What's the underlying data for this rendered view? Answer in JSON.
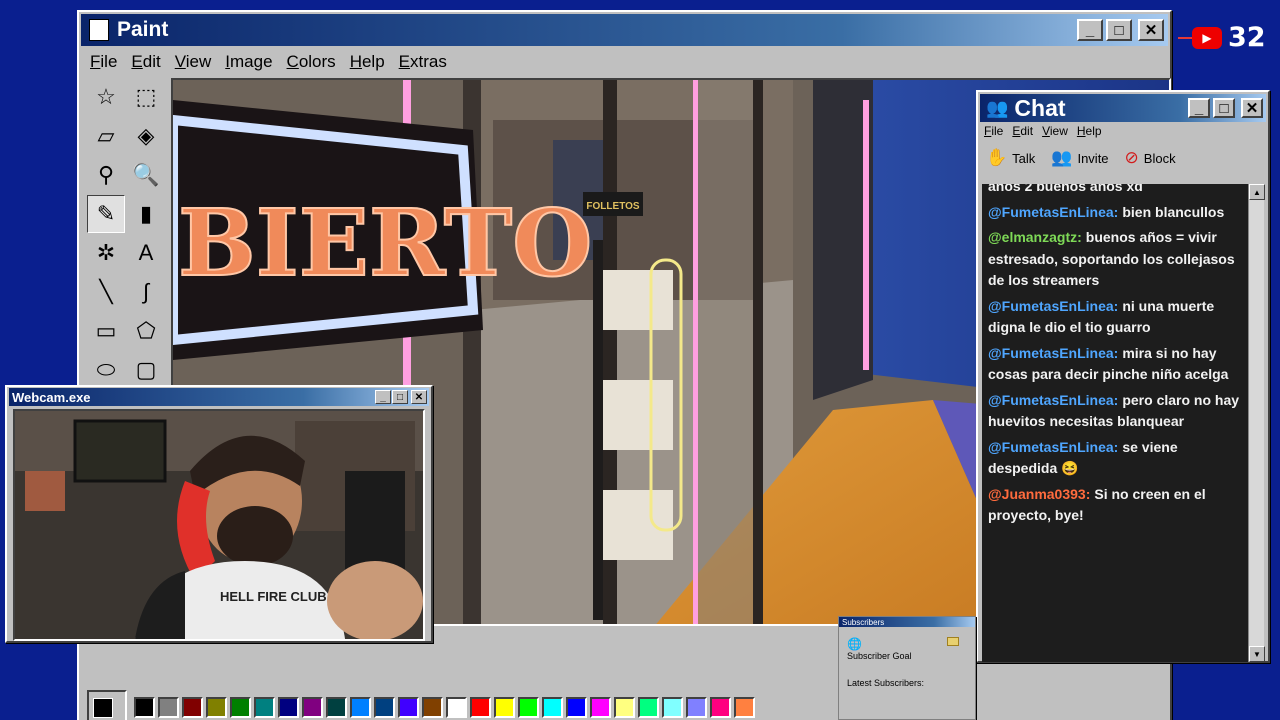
{
  "paint": {
    "title": "Paint",
    "menu": [
      "File",
      "Edit",
      "View",
      "Image",
      "Colors",
      "Help",
      "Extras"
    ],
    "tools": [
      {
        "name": "free-select-icon",
        "glyph": "☆"
      },
      {
        "name": "rect-select-icon",
        "glyph": "⬚"
      },
      {
        "name": "eraser-icon",
        "glyph": "▱"
      },
      {
        "name": "fill-bucket-icon",
        "glyph": "◈"
      },
      {
        "name": "color-picker-icon",
        "glyph": "⚲"
      },
      {
        "name": "magnifier-icon",
        "glyph": "🔍"
      },
      {
        "name": "pencil-icon",
        "glyph": "✎"
      },
      {
        "name": "brush-icon",
        "glyph": "▮"
      },
      {
        "name": "airbrush-icon",
        "glyph": "✲"
      },
      {
        "name": "text-tool-icon",
        "glyph": "A"
      },
      {
        "name": "line-tool-icon",
        "glyph": "╲"
      },
      {
        "name": "curve-tool-icon",
        "glyph": "∫"
      },
      {
        "name": "rectangle-tool-icon",
        "glyph": "▭"
      },
      {
        "name": "polygon-tool-icon",
        "glyph": "⬠"
      },
      {
        "name": "ellipse-tool-icon",
        "glyph": "⬭"
      },
      {
        "name": "rounded-rect-tool-icon",
        "glyph": "▢"
      }
    ],
    "palette": [
      "#000000",
      "#808080",
      "#800000",
      "#808000",
      "#008000",
      "#008080",
      "#000080",
      "#800080",
      "#004040",
      "#0080ff",
      "#004080",
      "#4000ff",
      "#804000",
      "#ffffff",
      "#ff0000",
      "#ffff00",
      "#00ff00",
      "#00ffff",
      "#0000ff",
      "#ff00ff",
      "#ffff80",
      "#00ff80",
      "#80ffff",
      "#8080ff",
      "#ff0080",
      "#ff8040"
    ],
    "scene_sign_text": "BIERTO",
    "scene_rack_label": "FOLLETOS"
  },
  "webcam": {
    "title": "Webcam.exe",
    "shirt_text": "HELL FIRE CLUB"
  },
  "chat": {
    "title": "Chat",
    "menu": [
      "File",
      "Edit",
      "View",
      "Help"
    ],
    "toolbar": [
      {
        "label": "Talk",
        "icon": "talk-icon",
        "glyph": "✋"
      },
      {
        "label": "Invite",
        "icon": "invite-icon",
        "glyph": "👥"
      },
      {
        "label": "Block",
        "icon": "block-icon",
        "glyph": "⊘"
      }
    ],
    "messages": [
      {
        "user": "",
        "text": "años 2 buenos años xd",
        "color": "#f2f2f2"
      },
      {
        "user": "@FumetasEnLinea:",
        "text": "bien blancullos",
        "color": "#4fa6ff"
      },
      {
        "user": "@elmanzagtz:",
        "text": "buenos años = vivir estresado, soportando los collejasos de los streamers",
        "color": "#7ed957"
      },
      {
        "user": "@FumetasEnLinea:",
        "text": "ni una muerte digna le dio el tio guarro",
        "color": "#4fa6ff"
      },
      {
        "user": "@FumetasEnLinea:",
        "text": "mira si no hay cosas para decir pinche niño acelga",
        "color": "#4fa6ff"
      },
      {
        "user": "@FumetasEnLinea:",
        "text": "pero claro no hay huevitos necesitas blanquear",
        "color": "#4fa6ff"
      },
      {
        "user": "@FumetasEnLinea:",
        "text": "se viene despedida 😆",
        "color": "#4fa6ff"
      },
      {
        "user": "@Juanma0393:",
        "text": "Si no creen en el proyecto, bye!",
        "color": "#ff6b3d"
      }
    ]
  },
  "subscribers": {
    "title": "Subscribers",
    "goal_label": "Subscriber Goal",
    "latest_label": "Latest Subscribers:"
  },
  "youtube": {
    "count": "32"
  }
}
